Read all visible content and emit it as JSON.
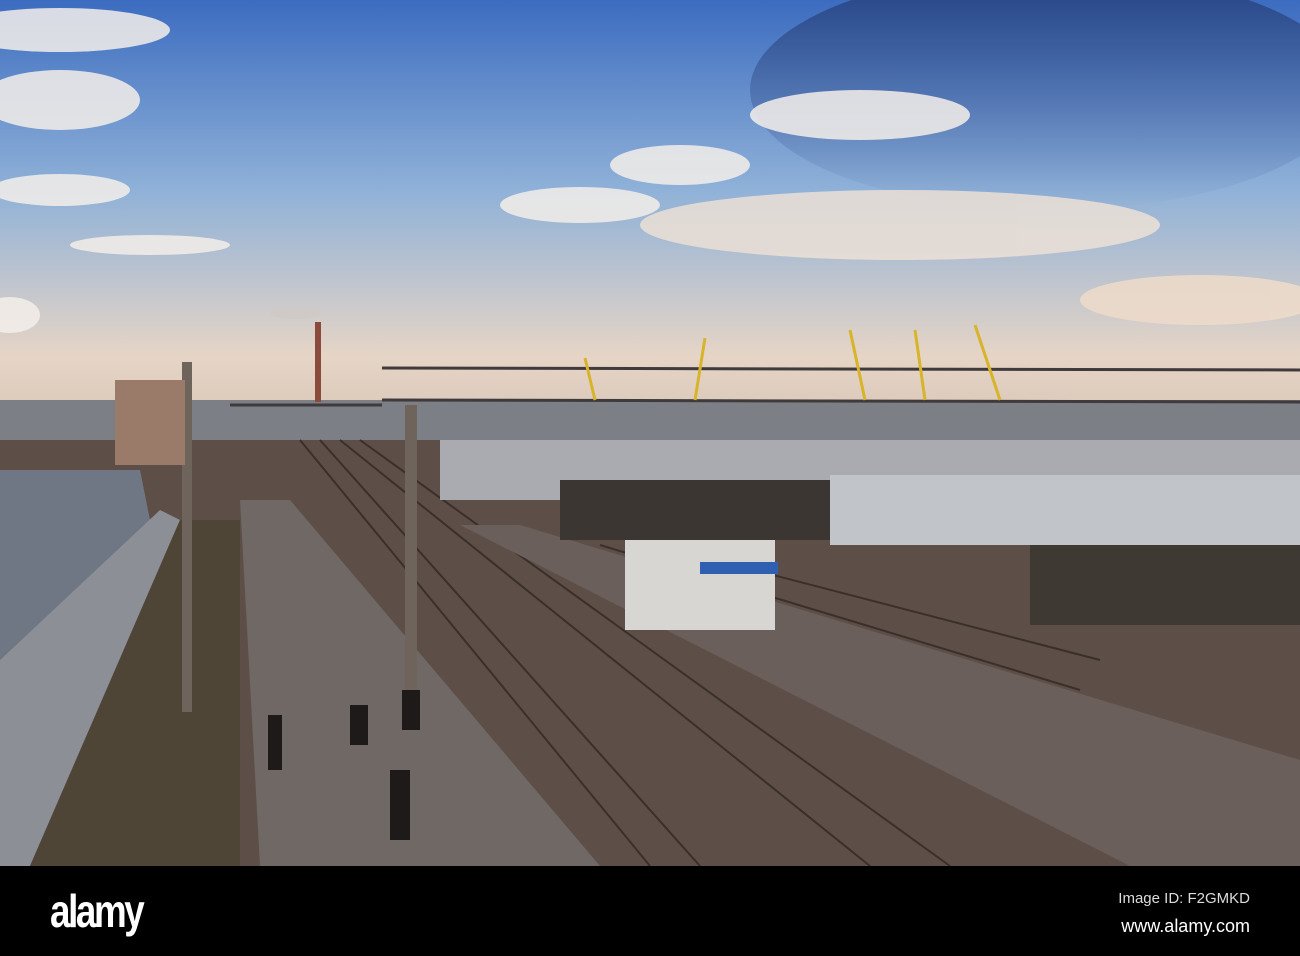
{
  "photo": {
    "subject": "railway-station"
  },
  "footer": {
    "brand": "alamy",
    "image_id": "Image ID: F2GMKD",
    "url": "www.alamy.com"
  },
  "colors": {
    "sky_top": "#3f6fc0",
    "sky_horizon": "#e8d6c4",
    "ground": "#5a4c44",
    "bar": "#000000"
  }
}
